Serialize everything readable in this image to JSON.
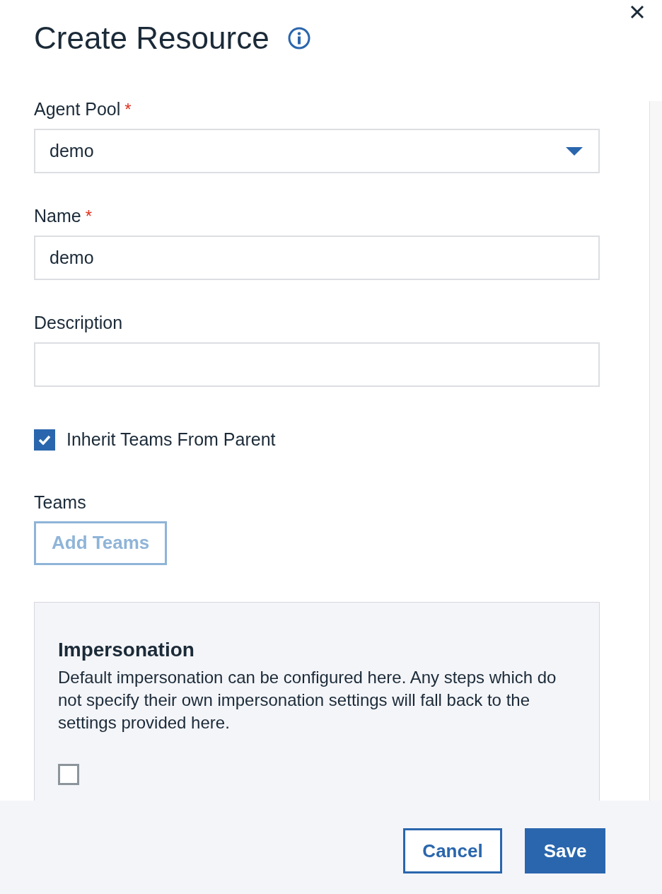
{
  "dialog": {
    "title": "Create Resource"
  },
  "fields": [
    {
      "label": "Agent Pool",
      "required_mark": "*",
      "kind": "dropdown",
      "value": "demo"
    },
    {
      "label": "Name",
      "required_mark": "*",
      "kind": "text",
      "value": "demo"
    },
    {
      "label": "Description",
      "kind": "text"
    }
  ],
  "inherit_teams": {
    "label": "Inherit Teams From Parent",
    "checked": true
  },
  "teams": {
    "label": "Teams",
    "button": {
      "label": "Add Teams",
      "disabled": true
    }
  },
  "impersonation": {
    "title": "Impersonation",
    "description": "Default impersonation can be configured here. Any steps which do not specify their own impersonation settings will fall back to the settings provided here.",
    "checkbox": {
      "checked": false
    }
  },
  "footer": {
    "buttons": [
      {
        "label": "Cancel",
        "kind": "secondary"
      },
      {
        "label": "Save",
        "kind": "primary"
      }
    ]
  }
}
